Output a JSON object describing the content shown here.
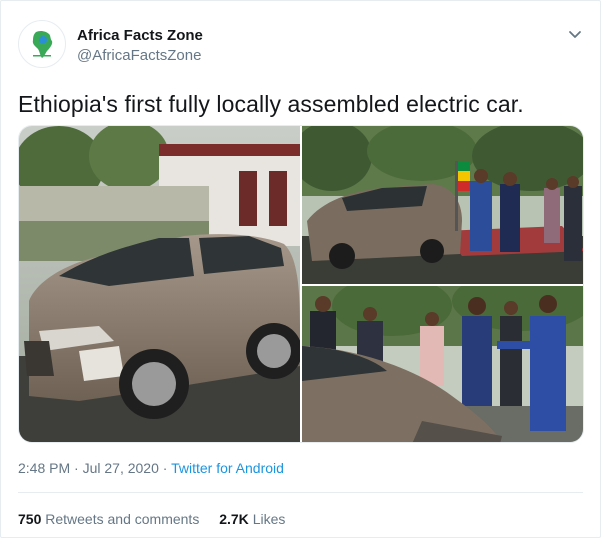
{
  "account": {
    "name": "Africa Facts Zone",
    "handle": "@AfricaFactsZone"
  },
  "tweet": {
    "text": "Ethiopia's first fully locally assembled electric car.",
    "time": "2:48 PM",
    "separator": "·",
    "date": "Jul 27, 2020",
    "source": "Twitter for Android"
  },
  "stats": {
    "retweets_count": "750",
    "retweets_label": "Retweets and comments",
    "likes_count": "2.7K",
    "likes_label": "Likes"
  },
  "icons": {
    "caret": "chevron-down-icon",
    "avatar": "africa-map-logo"
  },
  "colors": {
    "link": "#1b95e0",
    "secondary_text": "#657786",
    "primary_text": "#14171a",
    "border": "#e6ecf0",
    "car_body": "#8a7a6a"
  }
}
